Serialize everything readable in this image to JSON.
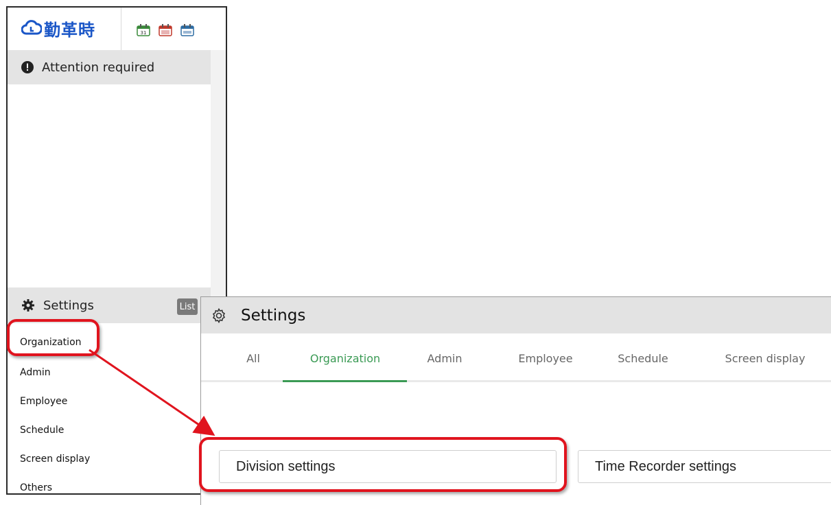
{
  "logo": {
    "text": "勤革時"
  },
  "toolbar_icons": [
    "calendar-31-icon",
    "calendar-monthly-icon",
    "calendar-yearly-icon"
  ],
  "sidebar": {
    "attention_label": "Attention required",
    "settings_label": "Settings",
    "list_badge": "List",
    "links": [
      "Organization",
      "Admin",
      "Employee",
      "Schedule",
      "Screen display",
      "Others"
    ]
  },
  "panel": {
    "title": "Settings",
    "tabs": [
      "All",
      "Organization",
      "Admin",
      "Employee",
      "Schedule",
      "Screen display"
    ],
    "active_tab": "Organization",
    "buttons": {
      "division": "Division settings",
      "time_recorder": "Time Recorder settings"
    }
  },
  "colors": {
    "accent_green": "#3a9a54",
    "callout_red": "#e0141e",
    "logo_blue": "#1a56c7"
  }
}
